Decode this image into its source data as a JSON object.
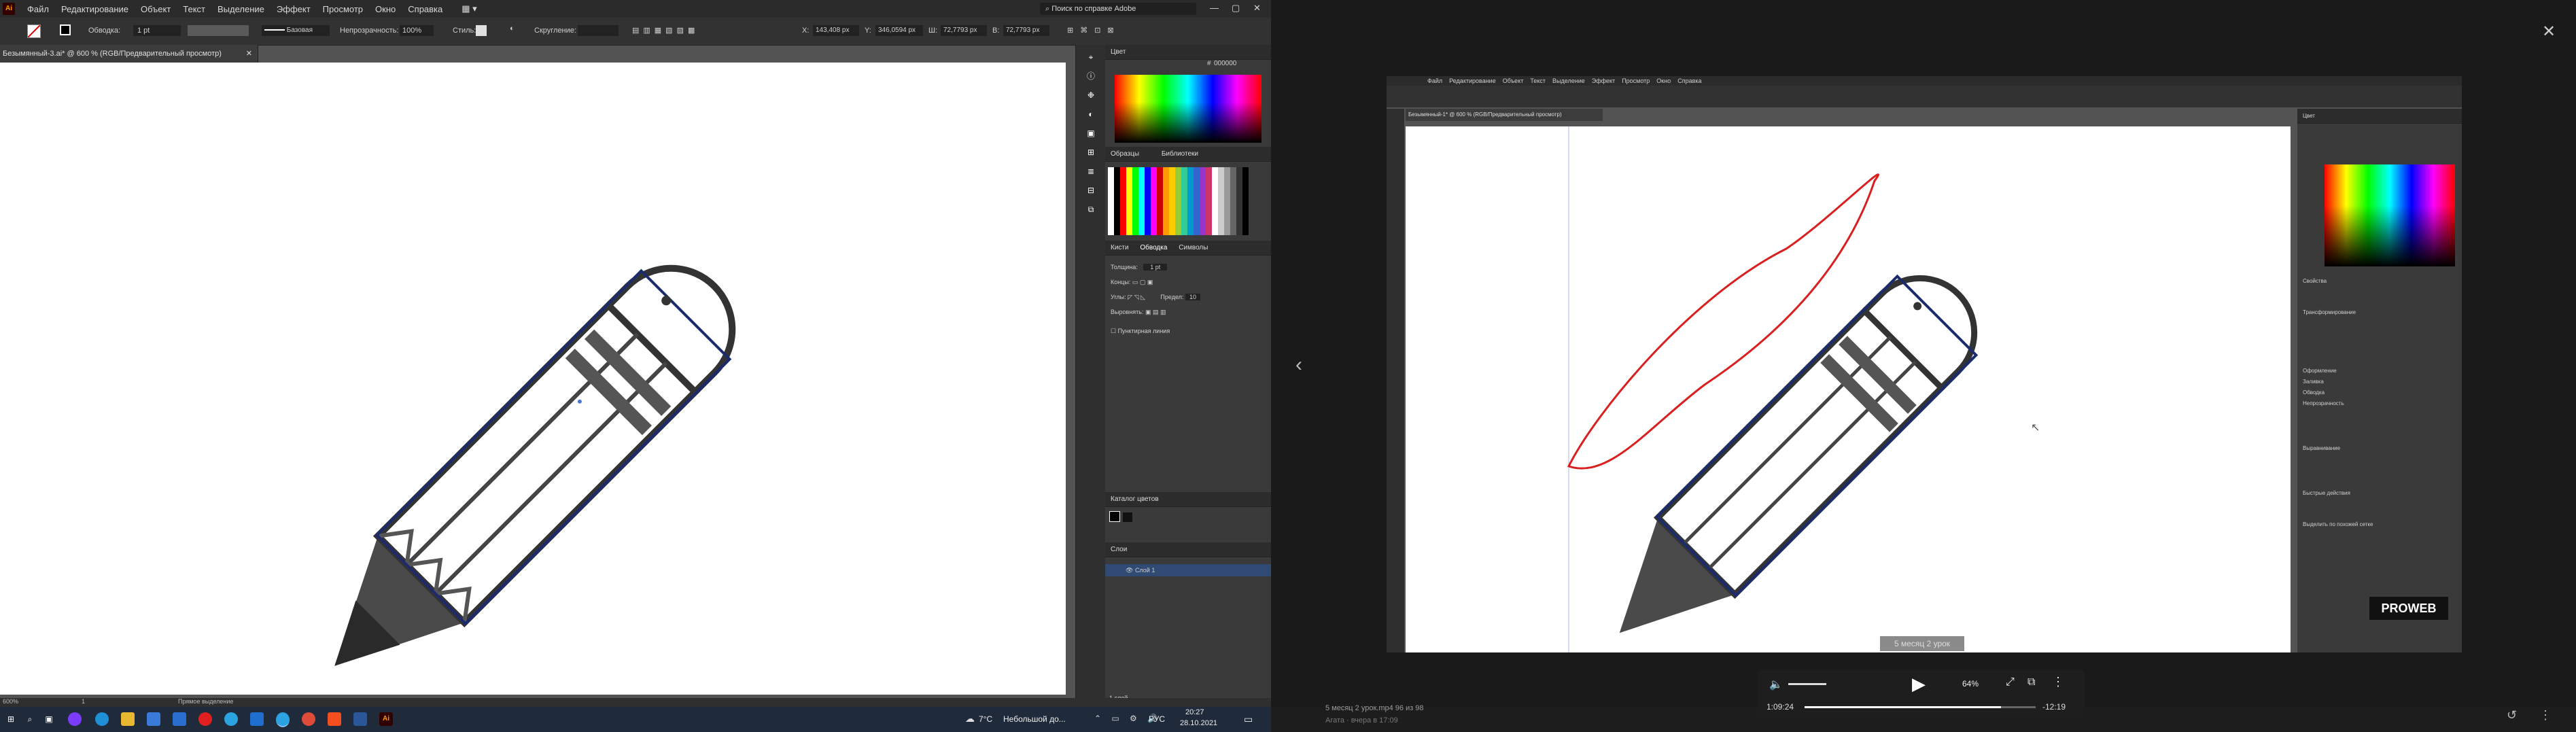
{
  "left_window": {
    "menu": [
      "Файл",
      "Редактирование",
      "Объект",
      "Текст",
      "Выделение",
      "Эффект",
      "Просмотр",
      "Окно",
      "Справка"
    ],
    "search_placeholder": "Поиск по справке Adobe",
    "control": {
      "stroke_label": "Обводка:",
      "stroke_value": "1 pt",
      "brush": "Базовая",
      "opacity_label": "Непрозрачность:",
      "opacity_value": "100%",
      "style_label": "Стиль:",
      "rounding_label": "Скругление:",
      "x_value": "143,408 px",
      "y_value": "346,0594 px",
      "w_value": "72,7793 px",
      "h_value": "72,7793 px"
    },
    "doc_tab": "Безымянный-3.ai* @ 600 % (RGB/Предварительный просмотр)",
    "color_panel": {
      "title": "Цвет",
      "hex": "000000"
    },
    "swatches_panel": {
      "tab1": "Образцы",
      "tab2": "Библиотеки"
    },
    "stroke_panel": {
      "tabs": [
        "Кисти",
        "Обводка",
        "Символы"
      ],
      "weight_label": "Толщина:",
      "weight_value": "1 pt",
      "cap_label": "Концы:",
      "corner_label": "Углы:",
      "limit_label": "Предел:",
      "limit_value": "10",
      "align_label": "Выровнять:",
      "dashed_label": "Пунктирная линия"
    },
    "color_guide": {
      "title": "Каталог цветов"
    },
    "layers": {
      "title": "Слои",
      "layer_name": "Слой 1",
      "footer": "1 слой"
    },
    "status": {
      "zoom": "600%",
      "page": "1",
      "tool": "Прямое выделение"
    }
  },
  "viewer": {
    "menu": [
      "Файл",
      "Редактирование",
      "Объект",
      "Текст",
      "Выделение",
      "Эффект",
      "Просмотр",
      "Окно",
      "Справка"
    ],
    "doc_tab": "Безымянный-1* @ 600 % (RGB/Предварительный просмотр)",
    "panel_tabs": [
      "Цвет"
    ],
    "properties_title": "Свойства",
    "transform_label": "Трансформирование",
    "appearance_label": "Оформление",
    "fill_label": "Заливка",
    "stroke_label": "Обводка",
    "opacity_label": "Непрозрачность",
    "quick_actions": "Быстрые действия",
    "align_label": "Выравнивание",
    "select_similar": "Выделить по похожей сетке",
    "watermark": "PROWEB",
    "caption": "5 месяц 2 урок",
    "video_title": "5 месяц 2 урок.mp4 96 из 98",
    "video_date": "Агата · вчера в 17:09",
    "player": {
      "speed": "64%",
      "elapsed": "1:09:24",
      "remaining": "-12:19",
      "progress": 0.85
    }
  },
  "taskbar": {
    "weather_temp": "7°C",
    "weather_text": "Небольшой до...",
    "lang": "РУС",
    "time": "20:27",
    "date": "28.10.2021"
  },
  "colors": {
    "accent_red": "#d91f1f",
    "ai_orange": "#ff7c00",
    "selection_blue": "#1a2b6e"
  }
}
